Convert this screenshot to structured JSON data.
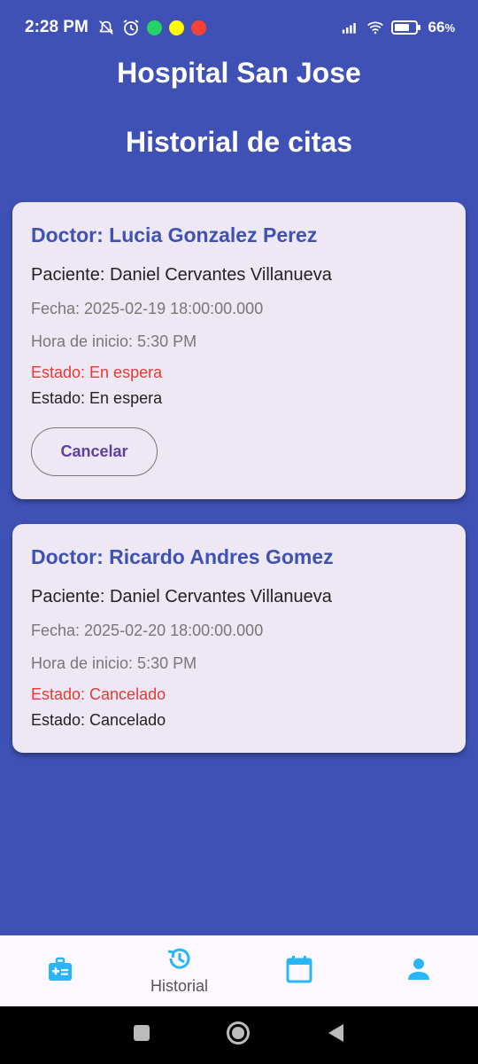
{
  "status_bar": {
    "time": "2:28 PM",
    "battery_percent": "66",
    "battery_suffix": "%",
    "icons": [
      "mute-icon",
      "alarm-icon",
      "whatsapp-icon",
      "snapchat-icon",
      "app-notification-icon",
      "signal-icon",
      "wifi-icon",
      "battery-icon"
    ]
  },
  "app": {
    "title": "Hospital San Jose",
    "page_title": "Historial de citas"
  },
  "appointments": [
    {
      "doctor": "Doctor: Lucia Gonzalez Perez",
      "patient": "Paciente: Daniel Cervantes Villanueva",
      "date": "Fecha: 2025-02-19 18:00:00.000",
      "start_time": "Hora de inicio: 5:30 PM",
      "status_highlight": "Estado: En espera",
      "status": "Estado: En espera",
      "cancel_label": "Cancelar"
    },
    {
      "doctor": "Doctor: Ricardo Andres Gomez",
      "patient": "Paciente: Daniel Cervantes Villanueva",
      "date": "Fecha: 2025-02-20 18:00:00.000",
      "start_time": "Hora de inicio: 5:30 PM",
      "status_highlight": "Estado: Cancelado",
      "status": "Estado: Cancelado"
    }
  ],
  "bottom_nav": {
    "items": [
      {
        "icon": "medical-kit-icon",
        "label": ""
      },
      {
        "icon": "history-icon",
        "label": "Historial",
        "active": true
      },
      {
        "icon": "calendar-icon",
        "label": ""
      },
      {
        "icon": "person-icon",
        "label": ""
      }
    ]
  },
  "colors": {
    "background": "#3f51b5",
    "card": "#ede8f3",
    "accent": "#3f51b5",
    "status_red": "#e53935",
    "nav_icon": "#29b6f6"
  }
}
